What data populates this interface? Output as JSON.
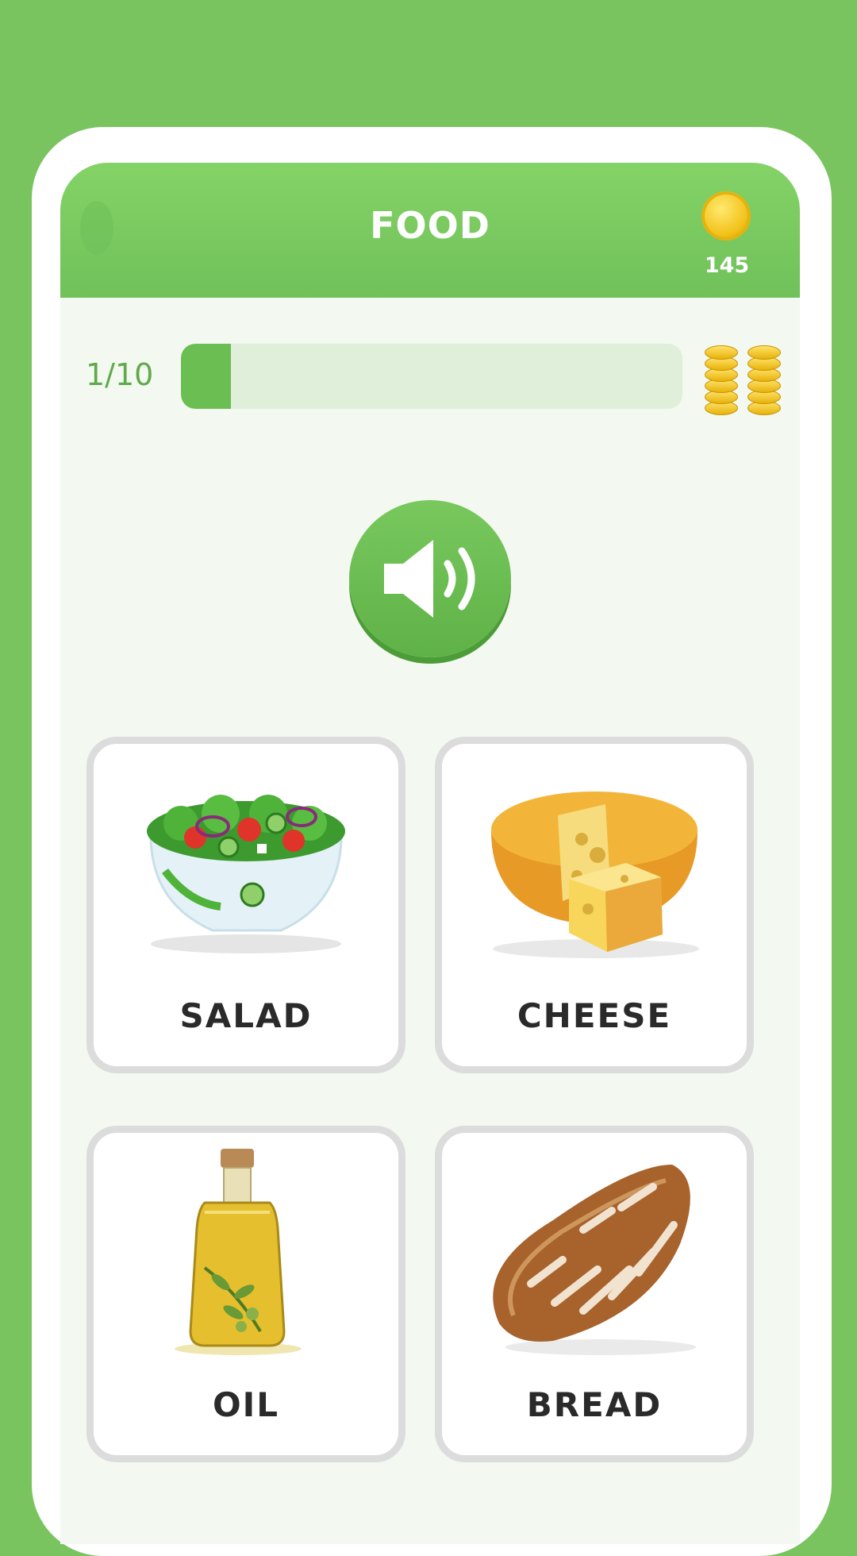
{
  "header": {
    "title": "FOOD",
    "coins": "145"
  },
  "progress": {
    "label": "1/10",
    "current": 1,
    "total": 10
  },
  "sound_button": {
    "icon": "speaker-icon"
  },
  "options": [
    {
      "label": "SALAD"
    },
    {
      "label": "CHEESE"
    },
    {
      "label": "OIL"
    },
    {
      "label": "BREAD"
    }
  ],
  "colors": {
    "background": "#79c45f",
    "header": "#74c55c",
    "accent": "#6bbf52",
    "card_border": "#dcdcdc",
    "coin": "#f2c21a"
  }
}
